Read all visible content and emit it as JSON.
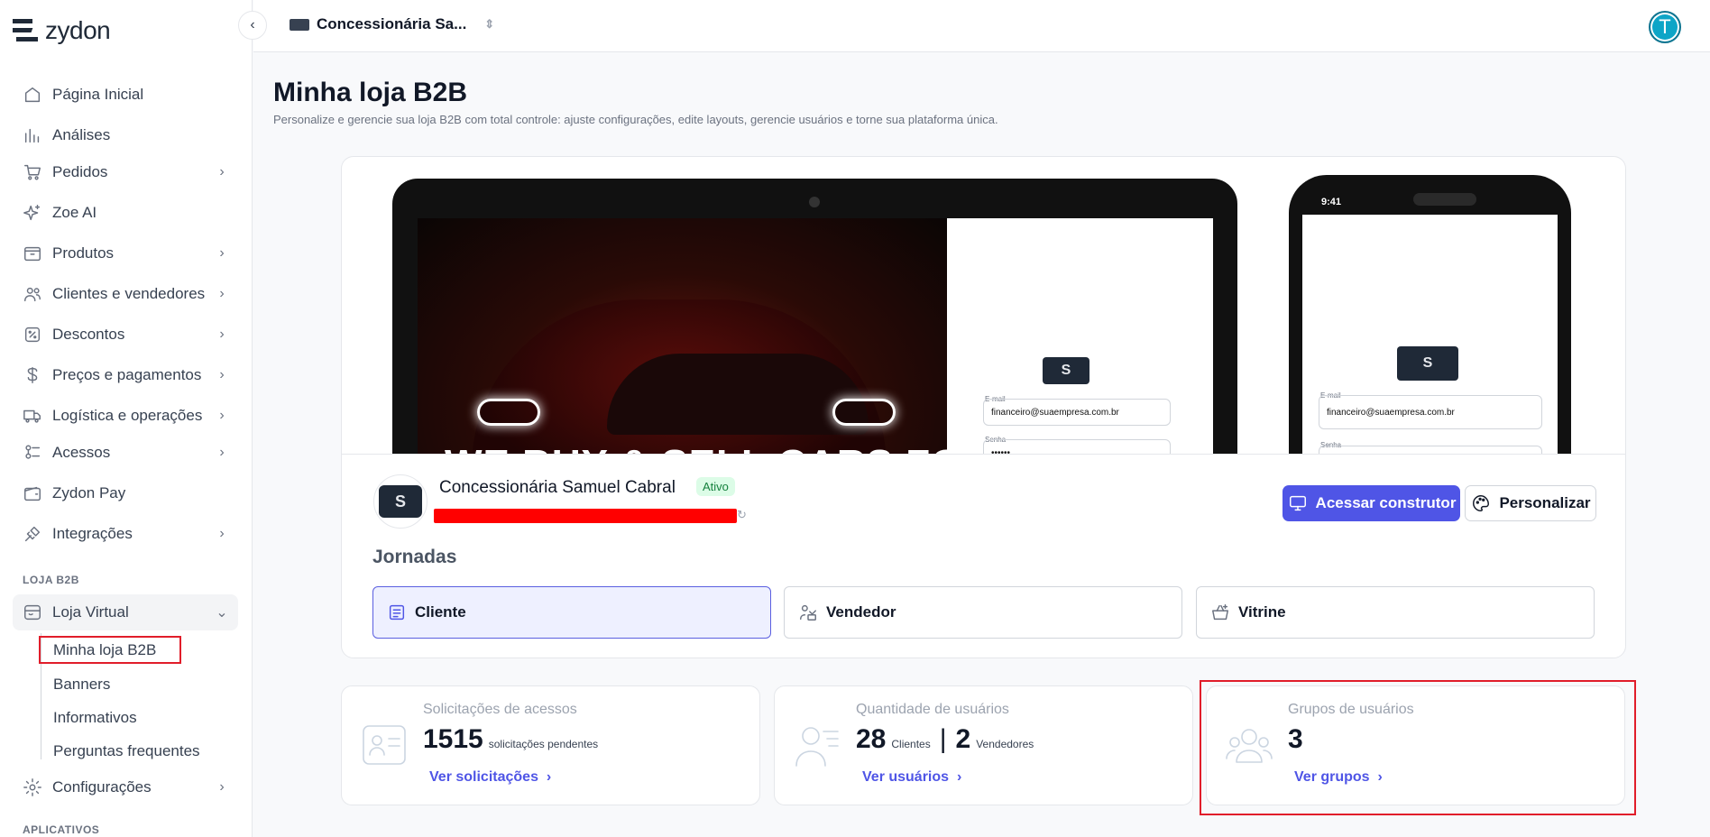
{
  "app": {
    "brand": "zydon"
  },
  "topbar": {
    "store_selector": "Concessionária Sa...",
    "avatar_initial": "T"
  },
  "sidebar": {
    "items": [
      {
        "label": "Página Inicial"
      },
      {
        "label": "Análises"
      },
      {
        "label": "Pedidos"
      },
      {
        "label": "Zoe AI"
      },
      {
        "label": "Produtos"
      },
      {
        "label": "Clientes e vendedores"
      },
      {
        "label": "Descontos"
      },
      {
        "label": "Preços e pagamentos"
      },
      {
        "label": "Logística e operações"
      },
      {
        "label": "Acessos"
      },
      {
        "label": "Zydon Pay"
      },
      {
        "label": "Integrações"
      }
    ],
    "section_b2b": "LOJA B2B",
    "loja_virtual": "Loja Virtual",
    "sub_items": [
      "Minha loja B2B",
      "Banners",
      "Informativos",
      "Perguntas frequentes"
    ],
    "config": "Configurações",
    "section_apps": "APLICATIVOS"
  },
  "page": {
    "title": "Minha loja B2B",
    "subtitle": "Personalize e gerencie sua loja B2B com total controle: ajuste configurações, edite layouts, gerencie usuários e torne sua plataforma única."
  },
  "preview": {
    "car_text": "WE BUY & SELL CARS FOR CASH",
    "email_label": "E-mail",
    "email_value": "financeiro@suaempresa.com.br",
    "password_label": "Senha",
    "password_value": "••••••",
    "phone_time": "9:41",
    "logo_text": "S"
  },
  "store": {
    "name": "Concessionária Samuel Cabral",
    "status": "Ativo",
    "btn_builder": "Acessar construtor",
    "btn_customize": "Personalizar"
  },
  "journeys": {
    "title": "Jornadas",
    "items": [
      {
        "label": "Cliente"
      },
      {
        "label": "Vendedor"
      },
      {
        "label": "Vitrine"
      }
    ],
    "active": "Cliente"
  },
  "stats": {
    "requests": {
      "title": "Solicitações de acessos",
      "value": "1515",
      "unit": "solicitações pendentes",
      "link": "Ver solicitações"
    },
    "users": {
      "title": "Quantidade de usuários",
      "clients": "28",
      "clients_label": "Clientes",
      "sellers": "2",
      "sellers_label": "Vendedores",
      "link": "Ver usuários"
    },
    "groups": {
      "title": "Grupos de usuários",
      "value": "3",
      "link": "Ver grupos"
    }
  },
  "colors": {
    "accent": "#4f55e6",
    "highlight": "#e11d2a",
    "status_bg": "#dcfce7",
    "avatar": "#0ea5c7"
  }
}
